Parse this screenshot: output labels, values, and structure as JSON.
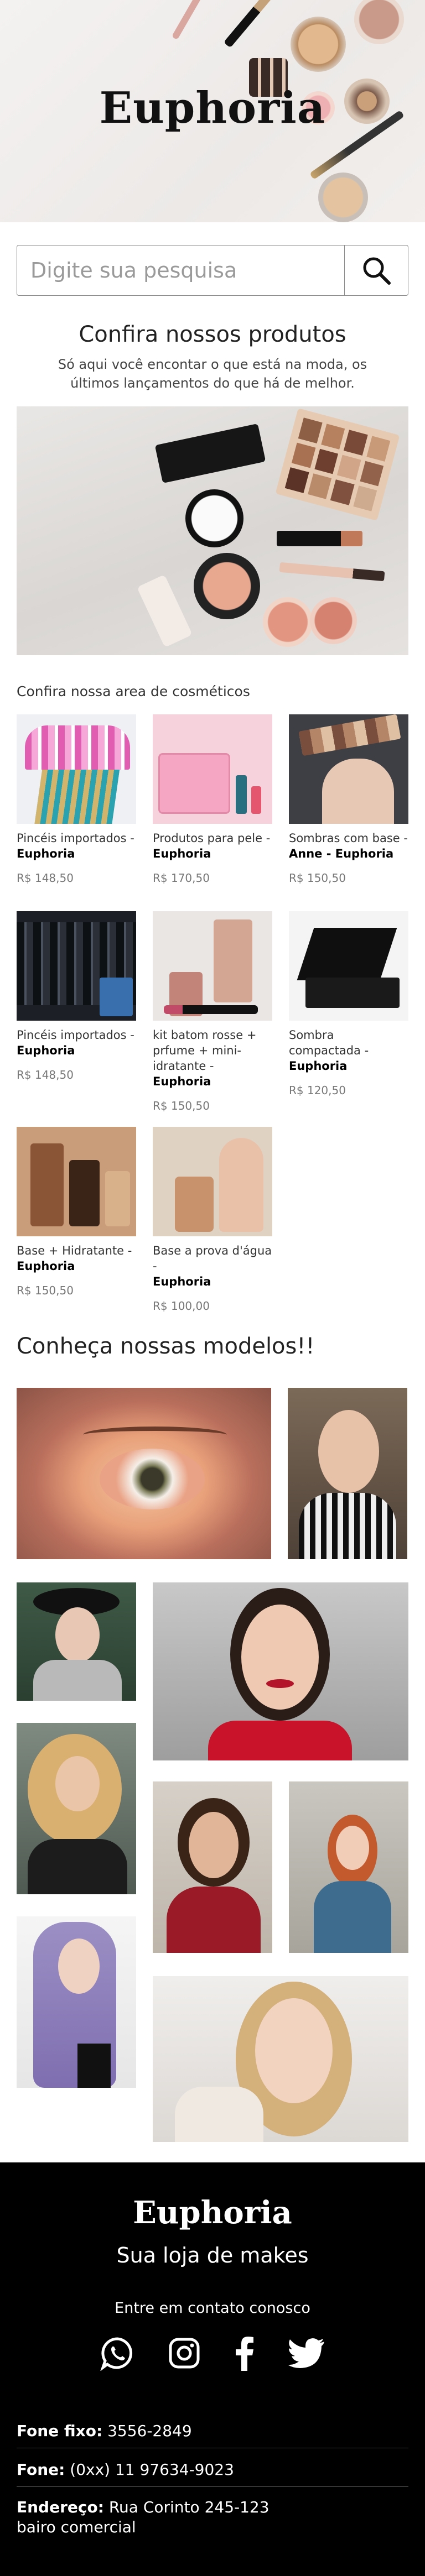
{
  "header": {
    "brand": "Euphoria"
  },
  "search": {
    "placeholder": "Digite sua pesquisa",
    "value": ""
  },
  "products_section": {
    "title": "Confira nossos produtos",
    "subtitle": "Só aqui você encontar o que está na moda, os últimos lançamentos do que há de melhor."
  },
  "catalog": {
    "title": "Confira nossa area de cosméticos",
    "products": [
      {
        "name": "Pincéis importados -",
        "brand": "Euphoria",
        "price": "R$ 148,50"
      },
      {
        "name": "Produtos para pele -",
        "brand": "Euphoria",
        "price": "R$ 170,50"
      },
      {
        "name": "Sombras com base -",
        "brand": "Anne - Euphoria",
        "price": "R$ 150,50"
      },
      {
        "name": "Pincéis importados -",
        "brand": "Euphoria",
        "price": "R$ 148,50"
      },
      {
        "name": "kit batom rosse + prfume + mini-idratante -",
        "brand": "Euphoria",
        "price": "R$ 150,50"
      },
      {
        "name": "Sombra compactada -",
        "brand": "Euphoria",
        "price": "R$ 120,50"
      },
      {
        "name": "Base + Hidratante -",
        "brand": "Euphoria",
        "price": "R$ 150,50"
      },
      {
        "name": "Base a prova d'água -",
        "brand": "Euphoria",
        "price": "R$ 100,00"
      }
    ]
  },
  "models": {
    "title": "Conheça nossas modelos!!"
  },
  "footer": {
    "brand": "Euphoria",
    "tagline": "Sua loja de makes",
    "contact_title": "Entre em contato conosco",
    "icons": [
      "whatsapp-icon",
      "instagram-icon",
      "facebook-icon",
      "twitter-icon"
    ],
    "phone_label": "Fone fixo:",
    "phone_value": "3556-2849",
    "mobile_label": "Fone:",
    "mobile_value": "(0xx) 11 97634-9023",
    "address_label": "Endereço:",
    "address_value": "Rua Corinto 245-123 bairo comercial"
  }
}
